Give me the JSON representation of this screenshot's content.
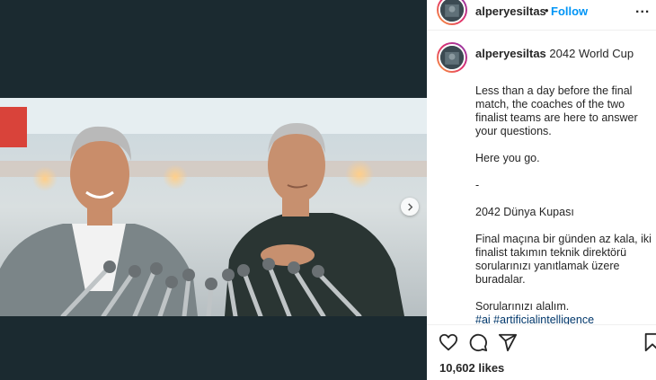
{
  "header": {
    "username": "alperyesiltas",
    "separator": "•",
    "follow_label": "Follow",
    "more_label": "..."
  },
  "caption": {
    "username": "alperyesiltas",
    "title": "2042 World Cup",
    "body": "Less than a day before the final match, the coaches of the two finalist teams are here to answer your questions.\n\nHere you go.\n\n-\n\n2042 Dünya Kupası\n\nFinal maçına bir günden az kala, iki finalist takımın teknik direktörü sorularınızı yanıtlamak üzere buradalar.\n\nSorularınızı alalım.\n",
    "hashtag_1": "#ai",
    "hashtag_2": "#artificialintelligence"
  },
  "actions": {
    "like_icon": "heart-icon",
    "comment_icon": "comment-icon",
    "share_icon": "share-icon",
    "save_icon": "bookmark-icon"
  },
  "likes": "10,602 likes",
  "colors": {
    "link_blue": "#0095f6",
    "hashtag": "#00376b",
    "media_bg": "#1b2a30"
  }
}
